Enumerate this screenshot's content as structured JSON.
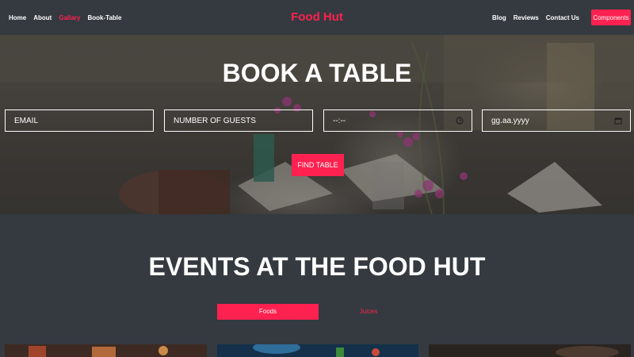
{
  "nav": {
    "left_links": [
      "Home",
      "About",
      "Gallary",
      "Book-Table"
    ],
    "active_link": "Gallary",
    "brand": "Food Hut",
    "right_links": [
      "Blog",
      "Reviews",
      "Contact Us"
    ],
    "components_button": "Components"
  },
  "hero": {
    "title": "BOOK A TABLE",
    "email_placeholder": "EMAIL",
    "guests_placeholder": "NUMBER OF GUESTS",
    "time_placeholder": "--:--",
    "date_placeholder": "gg.aa.yyyy",
    "find_button": "FIND TABLE"
  },
  "events": {
    "title": "EVENTS AT THE FOOD HUT",
    "tabs": [
      "Foods",
      "Juices"
    ],
    "active_tab": "Foods"
  },
  "colors": {
    "accent": "#ff214f",
    "background": "#343a40",
    "text": "#ffffff"
  }
}
